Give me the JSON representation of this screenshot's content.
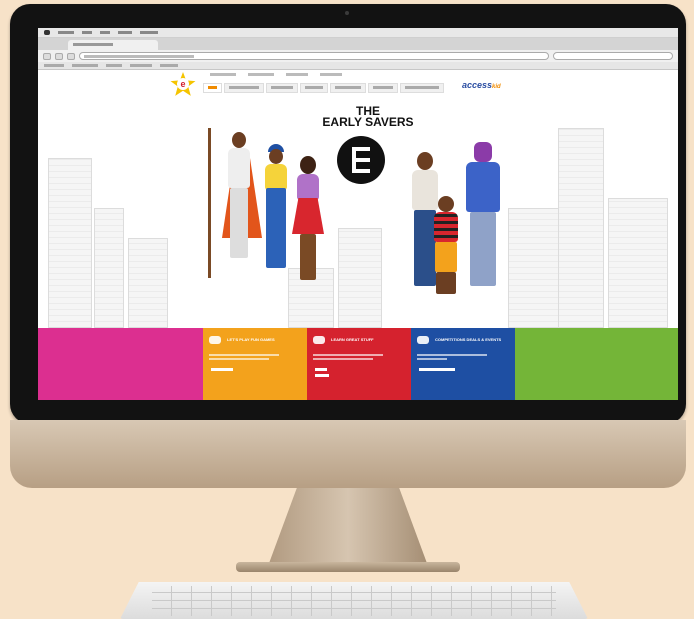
{
  "hero": {
    "title_line1": "THE",
    "title_line2": "EARLY SAVERS"
  },
  "brand": {
    "partner": "access",
    "partner_suffix": "kid"
  },
  "colors": {
    "pink": "#dc2f90",
    "orange": "#f3a21c",
    "red": "#d5222e",
    "blue": "#1e4fa3",
    "green": "#74b538",
    "logo_yellow": "#f5c400"
  },
  "panels": [
    {
      "title": "LET'S PLAY FUN GAMES",
      "icon": "gamepad-icon"
    },
    {
      "title": "LEARN GREAT STUFF",
      "icon": "hand-icon"
    },
    {
      "title": "COMPETITIONS DEALS & EVENTS",
      "icon": "piggy-bank-icon"
    }
  ]
}
